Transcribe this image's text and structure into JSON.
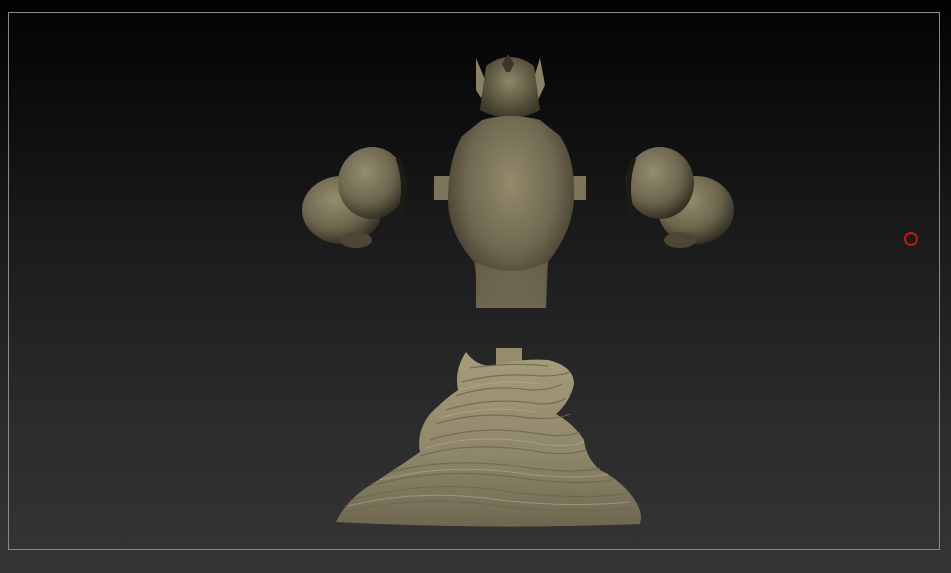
{
  "scene": {
    "model_color": "#8a8264",
    "model_shadow": "#3a3628",
    "model_highlight": "#b5ad8a",
    "base_color": "#a49b78",
    "pivot_marker_color": "#c0141a",
    "frame_color": "#8a8a8a",
    "icons": {
      "pivot": "circle-marker-icon"
    }
  }
}
